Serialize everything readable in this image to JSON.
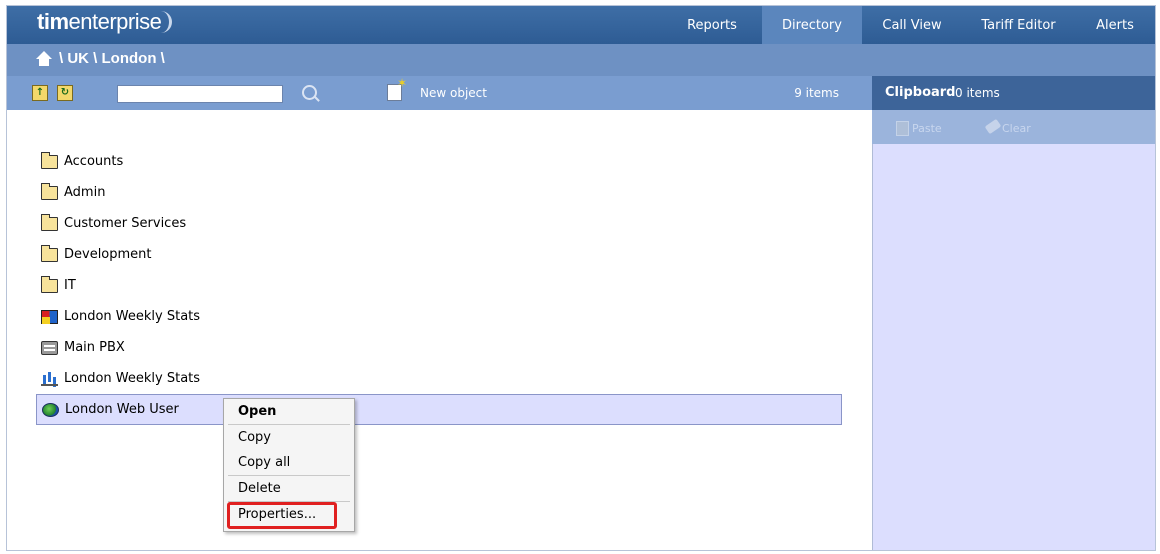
{
  "app": {
    "logo_bold": "tim",
    "logo_rest": "enterprise"
  },
  "nav": [
    {
      "label": "Reports",
      "active": false
    },
    {
      "label": "Directory",
      "active": true
    },
    {
      "label": "Call View",
      "active": false
    },
    {
      "label": "Tariff Editor",
      "active": false
    },
    {
      "label": "Alerts",
      "active": false
    }
  ],
  "breadcrumb": {
    "path": "\\ UK \\ London \\"
  },
  "toolbar": {
    "search_value": "",
    "new_object_label": "New object",
    "items_count": "9 items"
  },
  "clipboard": {
    "title": "Clipboard",
    "count": "0 items",
    "paste_label": "Paste",
    "clear_label": "Clear"
  },
  "directory": {
    "items": [
      {
        "label": "Accounts",
        "icon": "folder-icon"
      },
      {
        "label": "Admin",
        "icon": "folder-icon"
      },
      {
        "label": "Customer Services",
        "icon": "folder-icon"
      },
      {
        "label": "Development",
        "icon": "folder-icon"
      },
      {
        "label": "IT",
        "icon": "folder-icon"
      },
      {
        "label": "London Weekly Stats",
        "icon": "report-icon"
      },
      {
        "label": "Main PBX",
        "icon": "pbx-icon"
      },
      {
        "label": "London Weekly Stats",
        "icon": "stats-icon"
      },
      {
        "label": "London Web User",
        "icon": "globe-icon",
        "selected": true
      }
    ]
  },
  "context_menu": {
    "open": "Open",
    "copy": "Copy",
    "copy_all": "Copy all",
    "delete": "Delete",
    "properties": "Properties..."
  },
  "colors": {
    "topbar": "#2e5c94",
    "nav_active": "#5b86bd",
    "breadcrumb_bar": "#6e91c3",
    "toolbar": "#7a9dd0",
    "clipboard_header": "#3d6499",
    "clipboard_body": "#dcdefe",
    "highlight": "#e02020"
  }
}
